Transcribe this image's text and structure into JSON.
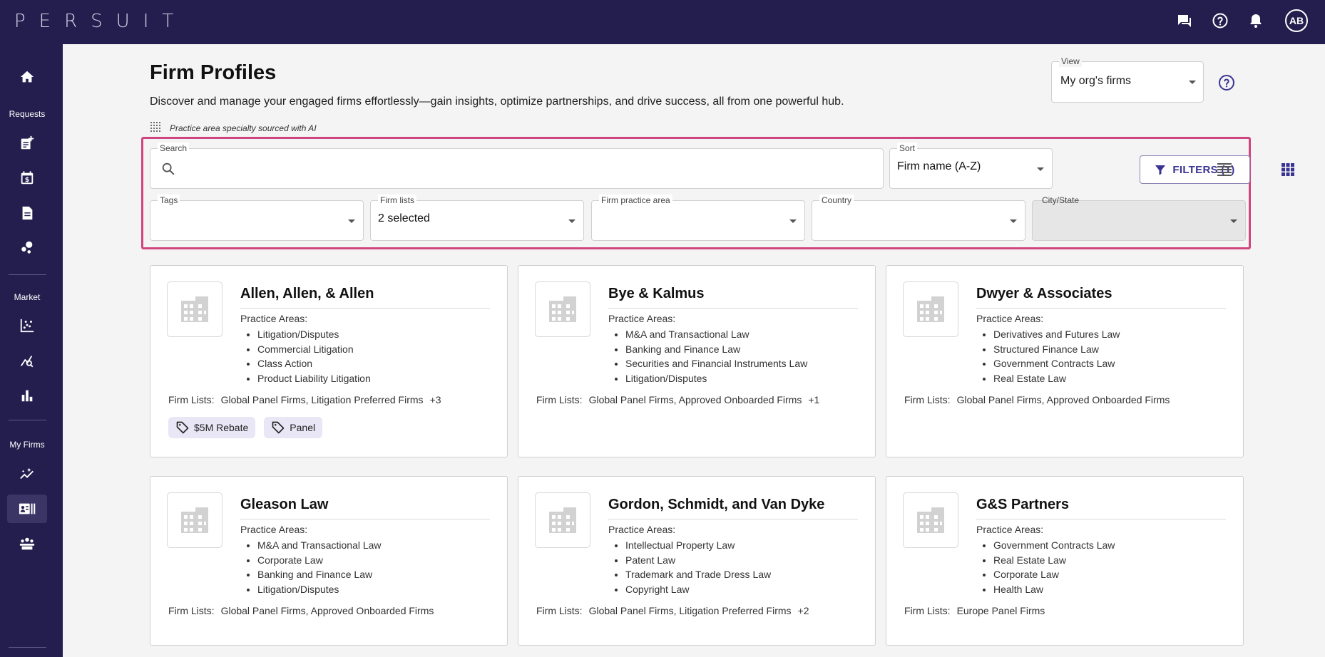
{
  "app": {
    "logo_text": "PERSUIT",
    "user_initials": "AB"
  },
  "sidebar": {
    "sections": {
      "requests": "Requests",
      "market": "Market",
      "my_firms": "My Firms"
    }
  },
  "header": {
    "title": "Firm Profiles",
    "description": "Discover and manage your engaged firms effortlessly—gain insights, optimize partnerships, and drive success, all from one powerful hub.",
    "ai_note": "Practice area specialty sourced with AI",
    "view": {
      "label": "View",
      "value": "My org's firms"
    }
  },
  "filters": {
    "search": {
      "label": "Search",
      "value": ""
    },
    "sort": {
      "label": "Sort",
      "value": "Firm name (A-Z)"
    },
    "filters_button": "FILTERS (1)",
    "tags": {
      "label": "Tags",
      "value": ""
    },
    "firm_lists": {
      "label": "Firm lists",
      "value": "2 selected"
    },
    "practice_area": {
      "label": "Firm practice area",
      "value": ""
    },
    "country": {
      "label": "Country",
      "value": ""
    },
    "city_state": {
      "label": "City/State",
      "value": ""
    }
  },
  "card_labels": {
    "practice_areas": "Practice Areas:",
    "firm_lists": "Firm Lists:"
  },
  "firms": [
    {
      "name": "Allen, Allen, & Allen",
      "practice_areas": [
        "Litigation/Disputes",
        "Commercial Litigation",
        "Class Action",
        "Product Liability Litigation"
      ],
      "firm_lists": "Global Panel Firms, Litigation Preferred Firms",
      "more": "+3",
      "tags": [
        "$5M Rebate",
        "Panel"
      ]
    },
    {
      "name": "Bye & Kalmus",
      "practice_areas": [
        "M&A and Transactional Law",
        "Banking and Finance Law",
        "Securities and Financial Instruments Law",
        "Litigation/Disputes"
      ],
      "firm_lists": "Global Panel Firms, Approved Onboarded Firms",
      "more": "+1",
      "tags": []
    },
    {
      "name": "Dwyer & Associates",
      "practice_areas": [
        "Derivatives and Futures Law",
        "Structured Finance Law",
        "Government Contracts Law",
        "Real Estate Law"
      ],
      "firm_lists": "Global Panel Firms, Approved Onboarded Firms",
      "more": "",
      "tags": []
    },
    {
      "name": "Gleason Law",
      "practice_areas": [
        "M&A and Transactional Law",
        "Corporate Law",
        "Banking and Finance Law",
        "Litigation/Disputes"
      ],
      "firm_lists": "Global Panel Firms, Approved Onboarded Firms",
      "more": "",
      "tags": []
    },
    {
      "name": "Gordon, Schmidt, and Van Dyke",
      "practice_areas": [
        "Intellectual Property Law",
        "Patent Law",
        "Trademark and Trade Dress Law",
        "Copyright Law"
      ],
      "firm_lists": "Global Panel Firms, Litigation Preferred Firms",
      "more": "+2",
      "tags": []
    },
    {
      "name": "G&S Partners",
      "practice_areas": [
        "Government Contracts Law",
        "Real Estate Law",
        "Corporate Law",
        "Health Law"
      ],
      "firm_lists": "Europe Panel Firms",
      "more": "",
      "tags": []
    }
  ]
}
